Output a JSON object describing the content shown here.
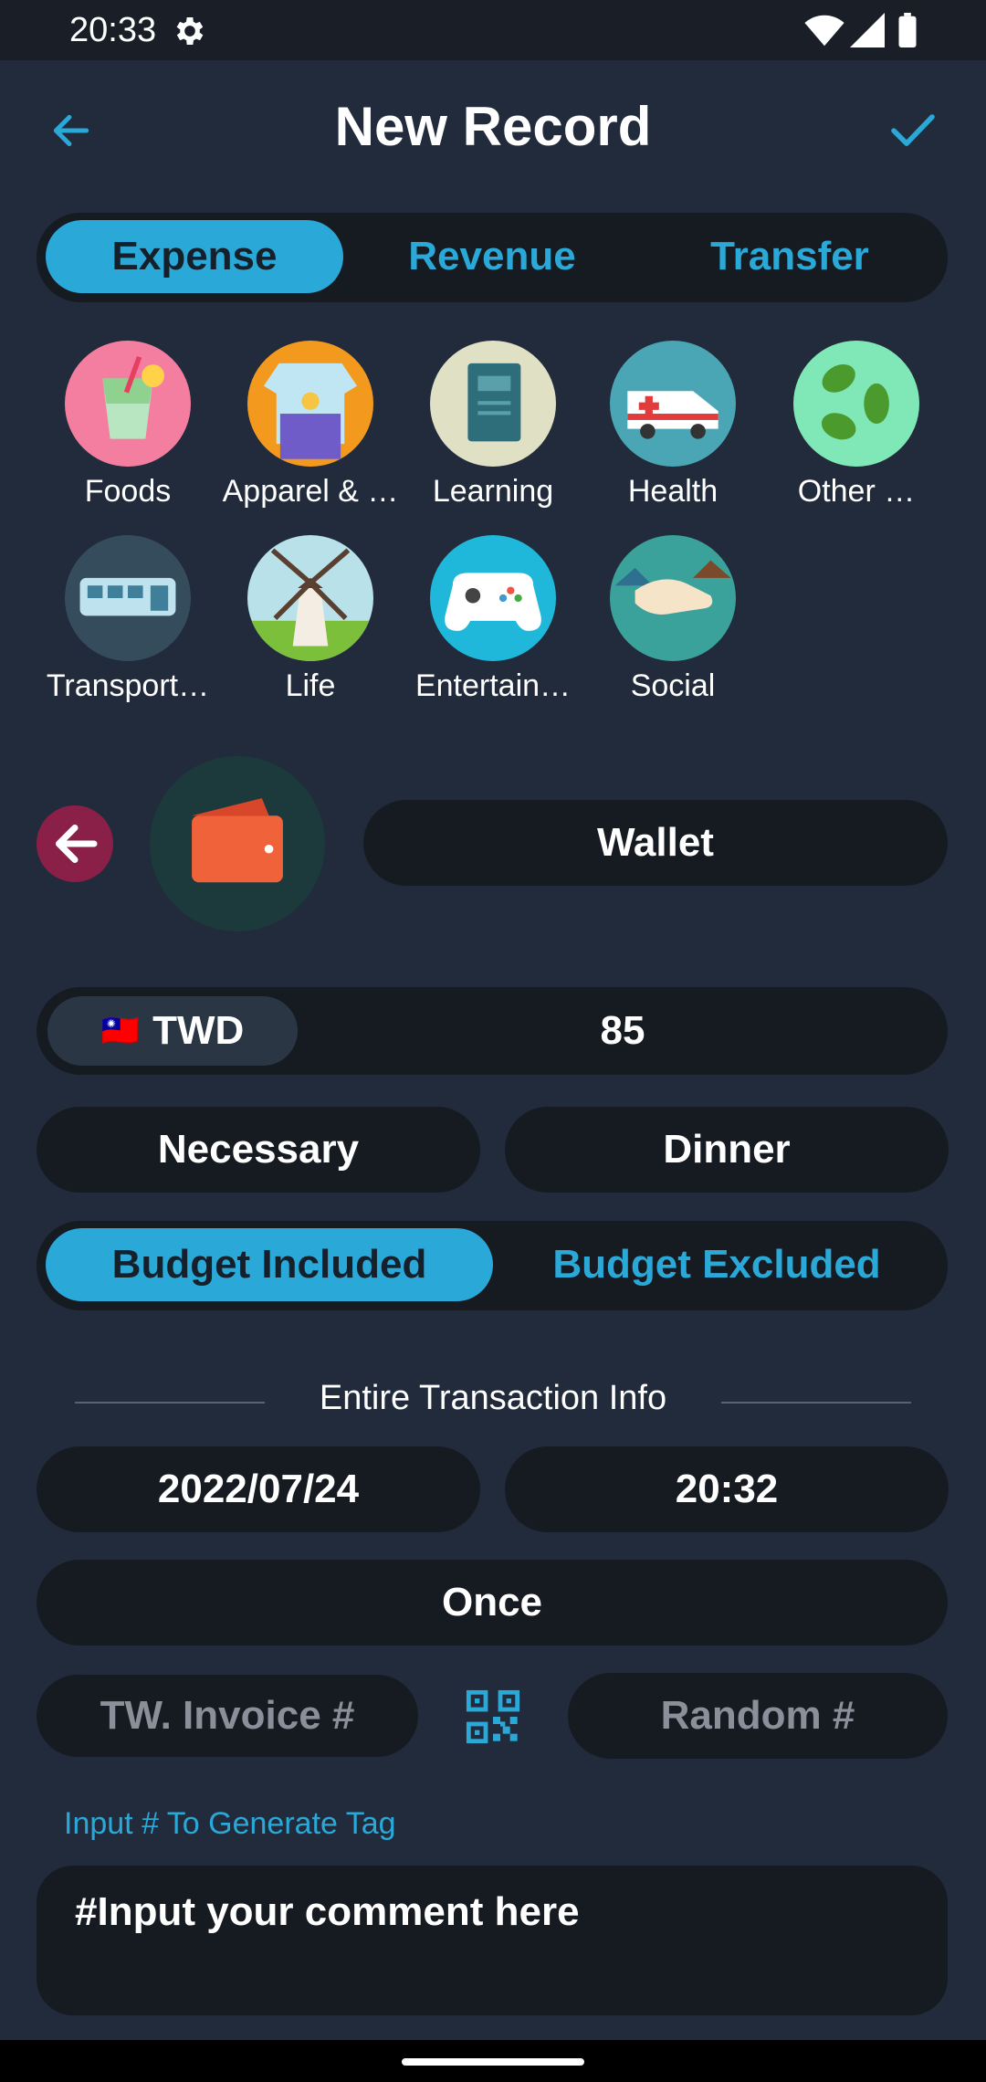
{
  "status_bar": {
    "time": "20:33"
  },
  "header": {
    "title": "New Record"
  },
  "type_tabs": [
    {
      "label": "Expense",
      "active": true
    },
    {
      "label": "Revenue",
      "active": false
    },
    {
      "label": "Transfer",
      "active": false
    }
  ],
  "categories": [
    {
      "label": "Foods",
      "icon": "foods-icon"
    },
    {
      "label": "Apparel & …",
      "icon": "apparel-icon"
    },
    {
      "label": "Learning",
      "icon": "learning-icon"
    },
    {
      "label": "Health",
      "icon": "health-icon"
    },
    {
      "label": "Other …",
      "icon": "other-icon"
    },
    {
      "label": "Transport…",
      "icon": "transport-icon"
    },
    {
      "label": "Life",
      "icon": "life-icon"
    },
    {
      "label": "Entertain…",
      "icon": "entertainment-icon"
    },
    {
      "label": "Social",
      "icon": "social-icon"
    }
  ],
  "account": {
    "name": "Wallet",
    "icon": "wallet-icon"
  },
  "amount": {
    "currency": "TWD",
    "flag": "🇹🇼",
    "value": "85"
  },
  "tags": {
    "left": "Necessary",
    "right": "Dinner"
  },
  "budget_tabs": [
    {
      "label": "Budget Included",
      "active": true
    },
    {
      "label": "Budget Excluded",
      "active": false
    }
  ],
  "transaction_info": {
    "heading": "Entire Transaction Info",
    "date": "2022/07/24",
    "time": "20:32",
    "repeat": "Once",
    "invoice_placeholder": "TW. Invoice #",
    "random_placeholder": "Random #"
  },
  "comment": {
    "hint": "Input # To Generate Tag",
    "placeholder": "#Input your comment here"
  },
  "colors": {
    "accent": "#2aa8d8",
    "background": "#212b3b",
    "field": "#161b22"
  }
}
